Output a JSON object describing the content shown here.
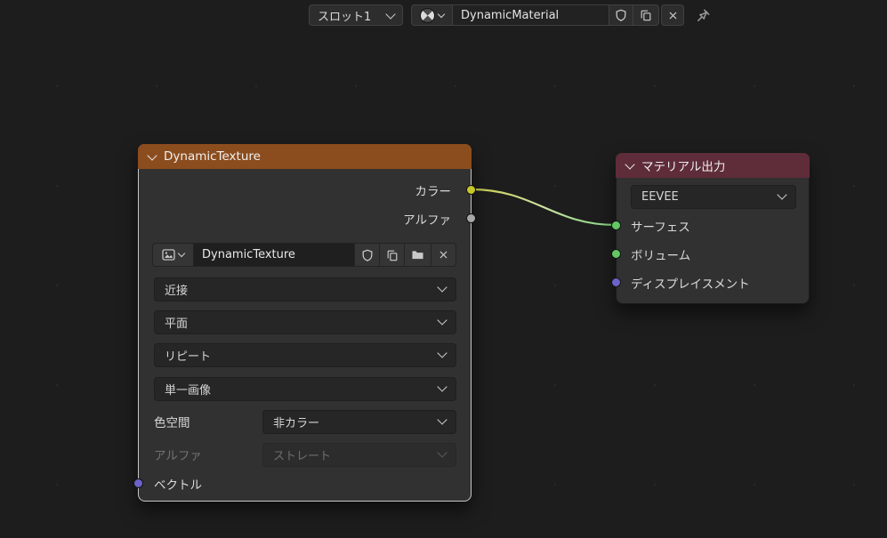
{
  "topbar": {
    "slot": {
      "label": "スロット1"
    },
    "material": {
      "name": "DynamicMaterial"
    }
  },
  "colors": {
    "texture_header": "#8c4d1e",
    "output_header": "#5f2c39",
    "socket_color": "#c7c729",
    "socket_alpha": "#a8a8a8",
    "socket_vector": "#6a63c8",
    "socket_shader": "#63c763",
    "wire_start": "#c9c94c",
    "wire_end": "#7ed47e"
  },
  "texture_node": {
    "title": "DynamicTexture",
    "outputs": [
      {
        "label": "カラー"
      },
      {
        "label": "アルファ"
      }
    ],
    "image_name": "DynamicTexture",
    "interpolation": "近接",
    "projection": "平面",
    "extension": "リピート",
    "source": "単一画像",
    "colorspace_label": "色空間",
    "colorspace_value": "非カラー",
    "alpha_label": "アルファ",
    "alpha_value": "ストレート",
    "vector_label": "ベクトル"
  },
  "output_node": {
    "title": "マテリアル出力",
    "engine": "EEVEE",
    "inputs": [
      {
        "label": "サーフェス"
      },
      {
        "label": "ボリューム"
      },
      {
        "label": "ディスプレイスメント"
      }
    ]
  }
}
